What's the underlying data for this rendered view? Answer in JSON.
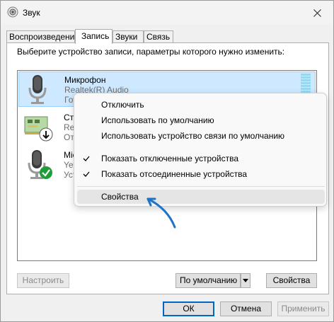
{
  "window": {
    "title": "Звук",
    "close_icon": "close-icon"
  },
  "tabs": [
    {
      "label": "Воспроизведение",
      "active": false
    },
    {
      "label": "Запись",
      "active": true
    },
    {
      "label": "Звуки",
      "active": false
    },
    {
      "label": "Связь",
      "active": false
    }
  ],
  "instruction": "Выберите устройство записи, параметры которого нужно изменить:",
  "devices": [
    {
      "name": "Микрофон",
      "driver": "Realtek(R) Audio",
      "status": "Готово",
      "icon": "microphone-icon",
      "selected": true
    },
    {
      "name": "Стерео микшер",
      "driver": "Realtek(R) Audio",
      "status": "Отключено",
      "icon": "sound-card-icon",
      "badge": "disabled-arrow-badge"
    },
    {
      "name": "Microphone",
      "driver": "Yeti Stereo Microphone",
      "status": "Устройство по умолчанию",
      "icon": "microphone-icon",
      "badge": "default-check-badge"
    }
  ],
  "device_texts_visible": {
    "d2_name": "Сте",
    "d2_driver": "Rea",
    "d2_status": "От",
    "d3_name": "Mic",
    "d3_driver": "Yet",
    "d3_status": "Уст",
    "d1_status": "Гот"
  },
  "context_menu": {
    "items": [
      {
        "label": "Отключить",
        "checked": false
      },
      {
        "label": "Использовать по умолчанию",
        "checked": false
      },
      {
        "label": "Использовать устройство связи по умолчанию",
        "checked": false
      },
      {
        "label": "Показать отключенные устройства",
        "checked": true
      },
      {
        "label": "Показать отсоединенные устройства",
        "checked": true
      },
      {
        "label": "Свойства",
        "checked": false,
        "highlighted": true
      }
    ]
  },
  "panel_buttons": {
    "configure": "Настроить",
    "default": "По умолчанию",
    "properties": "Свойства"
  },
  "dialog_buttons": {
    "ok": "ОК",
    "cancel": "Отмена",
    "apply": "Применить"
  },
  "colors": {
    "selection": "#cde8ff",
    "accent": "#0067c0",
    "annotation_arrow": "#1f73c8",
    "badge_green": "#1f9d3a"
  }
}
